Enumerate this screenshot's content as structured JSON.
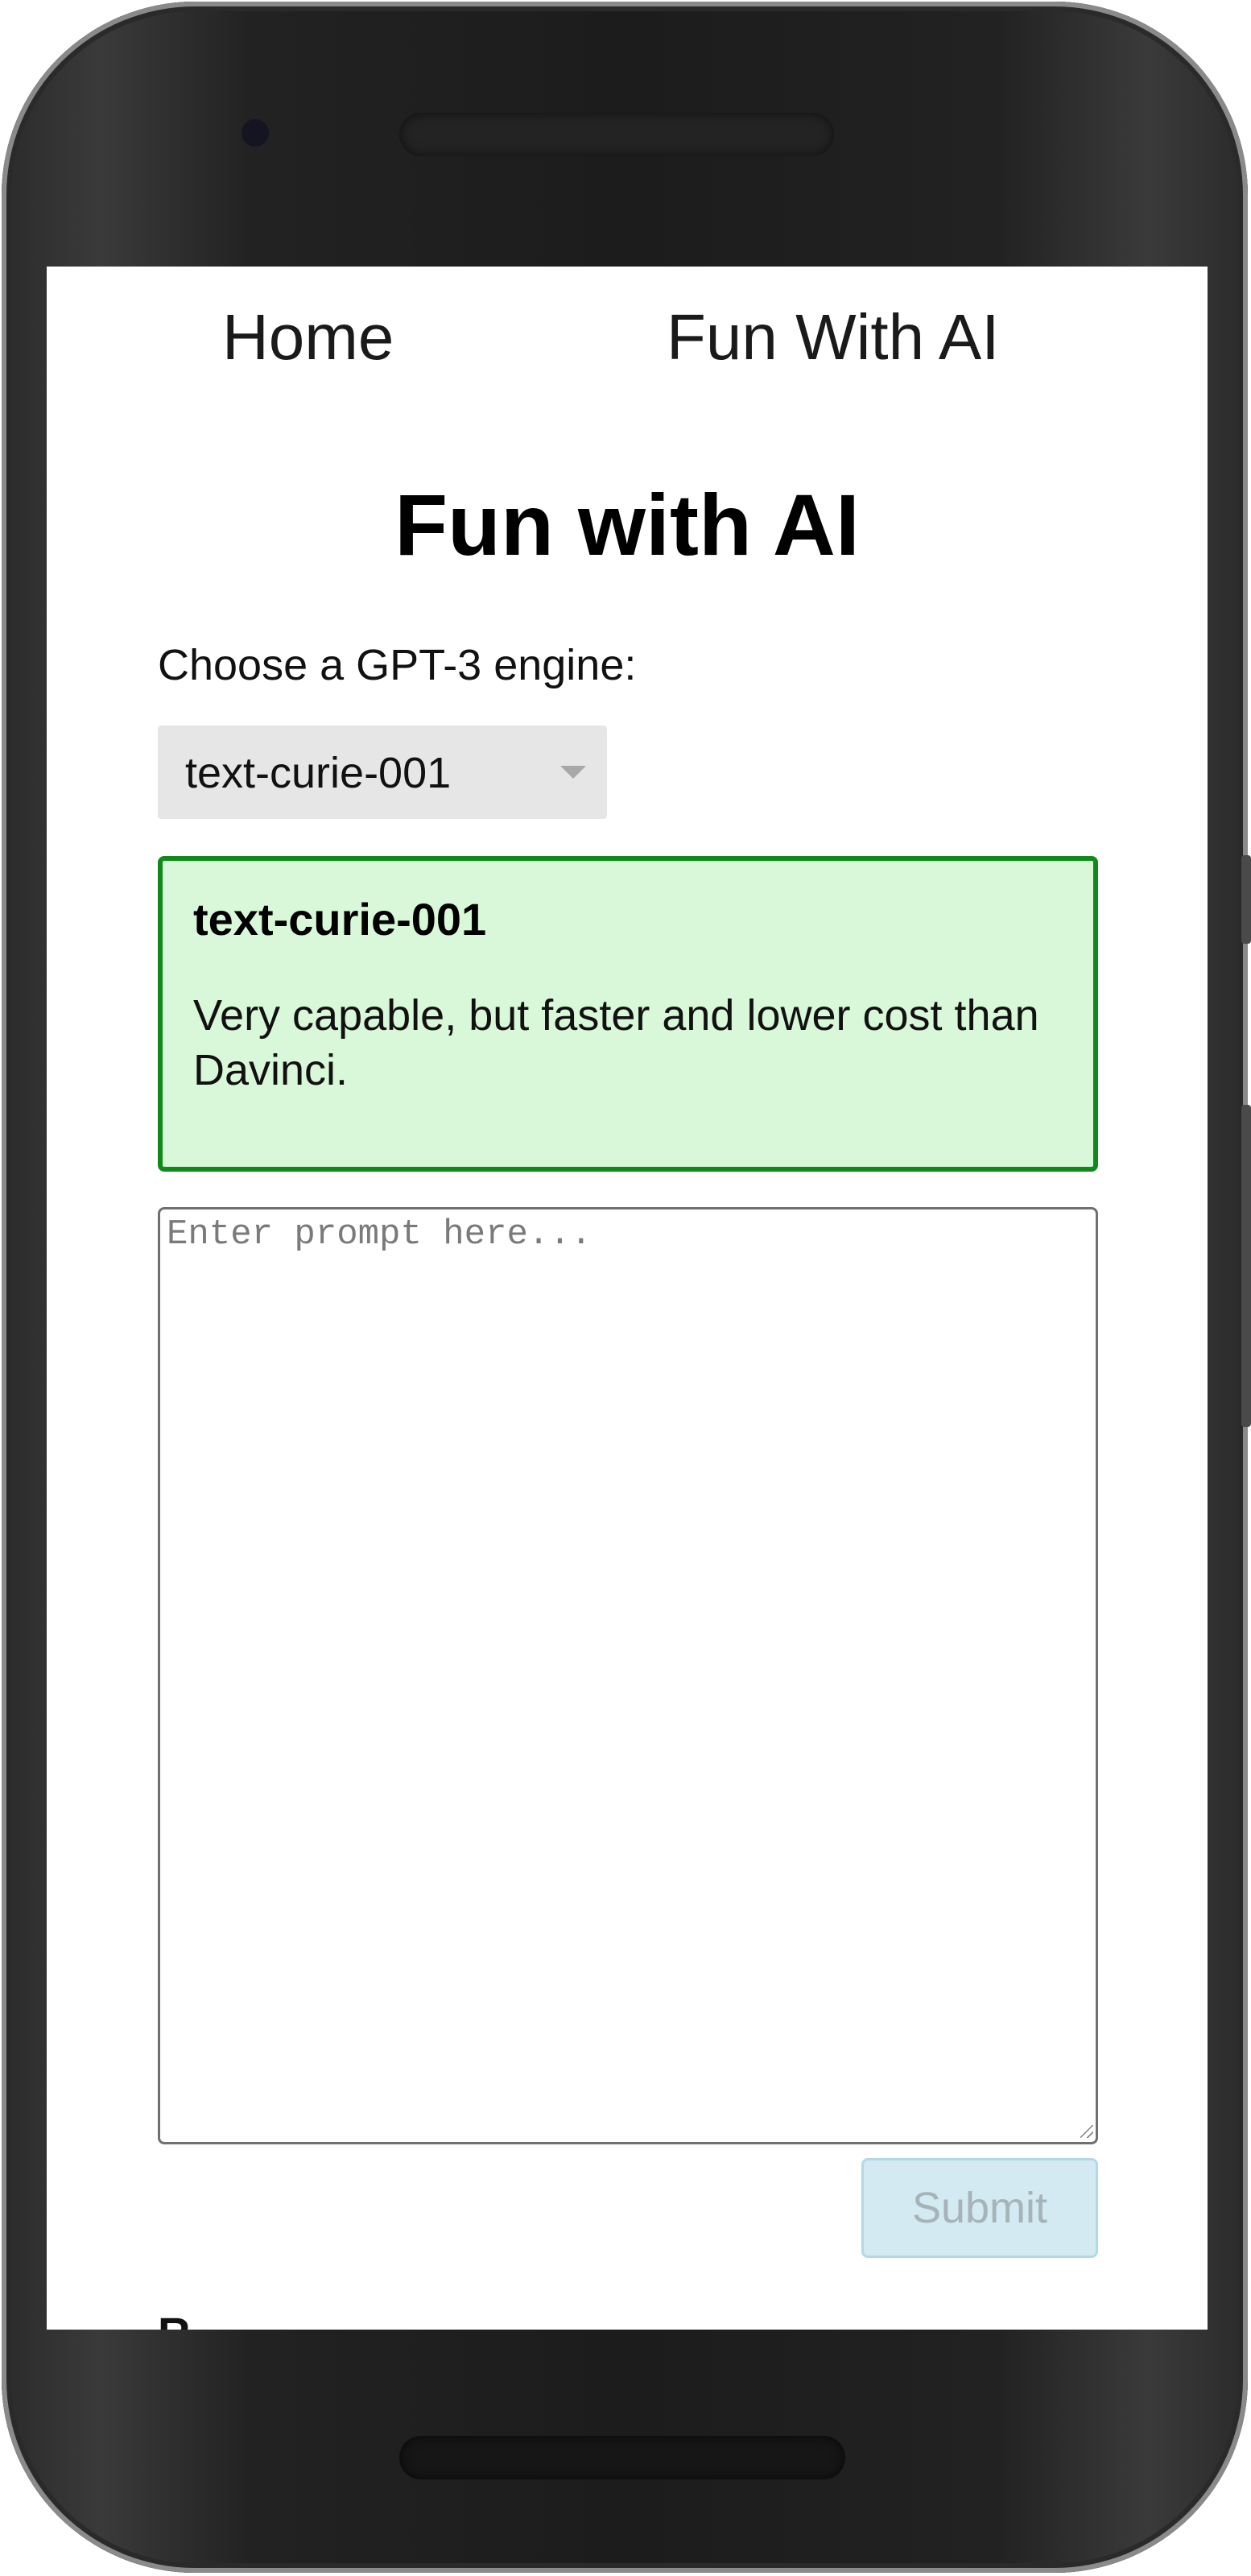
{
  "nav": {
    "home_label": "Home",
    "fun_label": "Fun With AI"
  },
  "page": {
    "title": "Fun with AI"
  },
  "engine": {
    "label": "Choose a GPT-3 engine:",
    "selected": "text-curie-001",
    "info_title": "text-curie-001",
    "info_description": "Very capable, but faster and lower cost than Davinci."
  },
  "prompt": {
    "placeholder": "Enter prompt here...",
    "value": ""
  },
  "submit": {
    "label": "Submit"
  },
  "responses": {
    "heading_partial": "R"
  },
  "colors": {
    "info_bg": "#d9f7d9",
    "info_border": "#0f8a1a",
    "submit_bg": "#d3eaf2",
    "submit_text": "#a6b3b8"
  }
}
